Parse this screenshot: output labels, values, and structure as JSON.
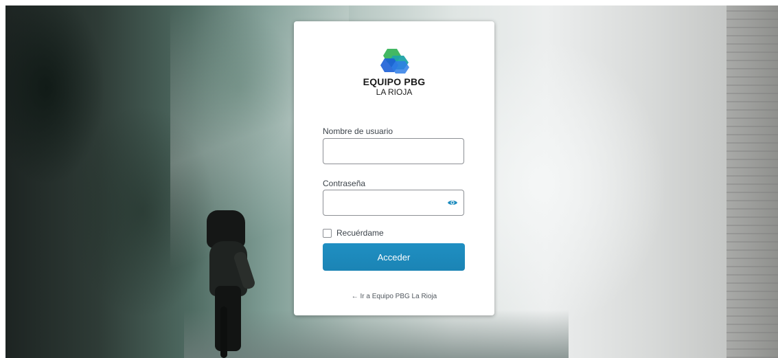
{
  "brand": {
    "name_line1": "EQUIPO PBG",
    "name_line2": "LA RIOJA",
    "logo_icon": "hexagon-stack-logo-icon",
    "colors": {
      "green": "#43b863",
      "teal": "#1fa3a8",
      "blue": "#1c5fd6"
    }
  },
  "login_form": {
    "username_label": "Nombre de usuario",
    "username_value": "",
    "password_label": "Contraseña",
    "password_value": "",
    "show_password_icon": "eye-icon",
    "remember_label": "Recuérdame",
    "remember_checked": false,
    "submit_label": "Acceder",
    "accent_color": "#1e8cbe"
  },
  "back_link": {
    "label": "← Ir a Equipo PBG La Rioja"
  }
}
